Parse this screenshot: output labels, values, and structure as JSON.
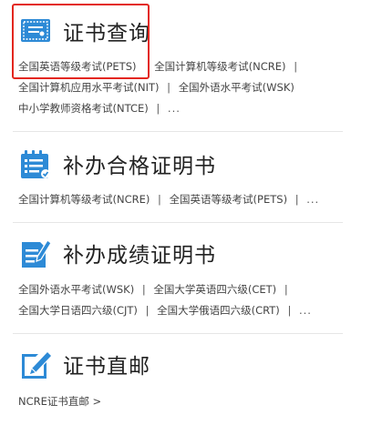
{
  "accent_color": "#2d8ad6",
  "highlight_color": "#e3261d",
  "sections": [
    {
      "icon": "certificate-icon",
      "title": "证书查询",
      "lines": [
        {
          "links": [
            "全国英语等级考试(PETS)",
            "全国计算机等级考试(NCRE)"
          ],
          "trailing_sep": true,
          "more": ""
        },
        {
          "links": [
            "全国计算机应用水平考试(NIT)",
            "全国外语水平考试(WSK)"
          ],
          "trailing_sep": false,
          "more": ""
        },
        {
          "links": [
            "中小学教师资格考试(NTCE)"
          ],
          "trailing_sep": true,
          "more": "..."
        }
      ]
    },
    {
      "icon": "checklist-icon",
      "title": "补办合格证明书",
      "lines": [
        {
          "links": [
            "全国计算机等级考试(NCRE)",
            "全国英语等级考试(PETS)"
          ],
          "trailing_sep": true,
          "more": "..."
        }
      ]
    },
    {
      "icon": "document-edit-icon",
      "title": "补办成绩证明书",
      "lines": [
        {
          "links": [
            "全国外语水平考试(WSK)",
            "全国大学英语四六级(CET)"
          ],
          "trailing_sep": true,
          "more": ""
        },
        {
          "links": [
            "全国大学日语四六级(CJT)",
            "全国大学俄语四六级(CRT)"
          ],
          "trailing_sep": true,
          "more": "..."
        }
      ]
    },
    {
      "icon": "pencil-square-icon",
      "title": "证书直邮",
      "lines": [
        {
          "links": [
            "NCRE证书直邮 >"
          ],
          "trailing_sep": false,
          "more": ""
        }
      ]
    }
  ]
}
